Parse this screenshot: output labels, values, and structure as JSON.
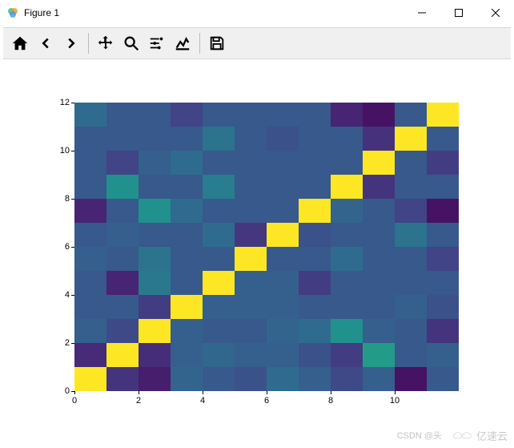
{
  "window": {
    "title": "Figure 1"
  },
  "toolbar": {
    "home": "Home",
    "back": "Back",
    "forward": "Forward",
    "pan": "Pan",
    "zoom": "Zoom",
    "configure": "Configure subplots",
    "edit": "Edit axis",
    "save": "Save"
  },
  "watermarks": {
    "csdn": "CSDN @头",
    "yisu": "亿速云"
  },
  "chart_data": {
    "type": "heatmap",
    "title": "",
    "xlabel": "",
    "ylabel": "",
    "xlim": [
      0,
      12
    ],
    "ylim": [
      0,
      12
    ],
    "xticks": [
      0,
      2,
      4,
      6,
      8,
      10
    ],
    "yticks": [
      0,
      2,
      4,
      6,
      8,
      10,
      12
    ],
    "colormap": "viridis",
    "note": "12x12 matrix, diagonal = 1.0 (yellow), off-diagonal random ~[0,0.55]; row 0 at bottom",
    "values": [
      [
        1.0,
        0.15,
        0.08,
        0.32,
        0.28,
        0.25,
        0.35,
        0.3,
        0.22,
        0.3,
        0.05,
        0.28
      ],
      [
        0.12,
        1.0,
        0.13,
        0.3,
        0.33,
        0.3,
        0.3,
        0.25,
        0.18,
        0.55,
        0.28,
        0.3
      ],
      [
        0.3,
        0.22,
        1.0,
        0.3,
        0.28,
        0.28,
        0.32,
        0.35,
        0.5,
        0.3,
        0.28,
        0.15
      ],
      [
        0.28,
        0.28,
        0.18,
        1.0,
        0.3,
        0.3,
        0.3,
        0.28,
        0.28,
        0.28,
        0.3,
        0.25
      ],
      [
        0.28,
        0.1,
        0.4,
        0.28,
        1.0,
        0.3,
        0.3,
        0.18,
        0.28,
        0.28,
        0.28,
        0.28
      ],
      [
        0.3,
        0.28,
        0.38,
        0.28,
        0.28,
        1.0,
        0.28,
        0.28,
        0.35,
        0.28,
        0.28,
        0.2
      ],
      [
        0.28,
        0.3,
        0.28,
        0.28,
        0.35,
        0.16,
        1.0,
        0.25,
        0.28,
        0.28,
        0.38,
        0.28
      ],
      [
        0.1,
        0.28,
        0.5,
        0.35,
        0.28,
        0.28,
        0.28,
        1.0,
        0.32,
        0.28,
        0.2,
        0.05
      ],
      [
        0.28,
        0.5,
        0.28,
        0.28,
        0.42,
        0.28,
        0.28,
        0.28,
        1.0,
        0.15,
        0.28,
        0.28
      ],
      [
        0.28,
        0.2,
        0.3,
        0.35,
        0.28,
        0.28,
        0.28,
        0.28,
        0.28,
        1.0,
        0.28,
        0.18
      ],
      [
        0.28,
        0.28,
        0.28,
        0.28,
        0.38,
        0.28,
        0.25,
        0.28,
        0.28,
        0.14,
        1.0,
        0.28
      ],
      [
        0.35,
        0.28,
        0.28,
        0.2,
        0.28,
        0.28,
        0.28,
        0.28,
        0.1,
        0.05,
        0.28,
        1.0
      ]
    ]
  }
}
